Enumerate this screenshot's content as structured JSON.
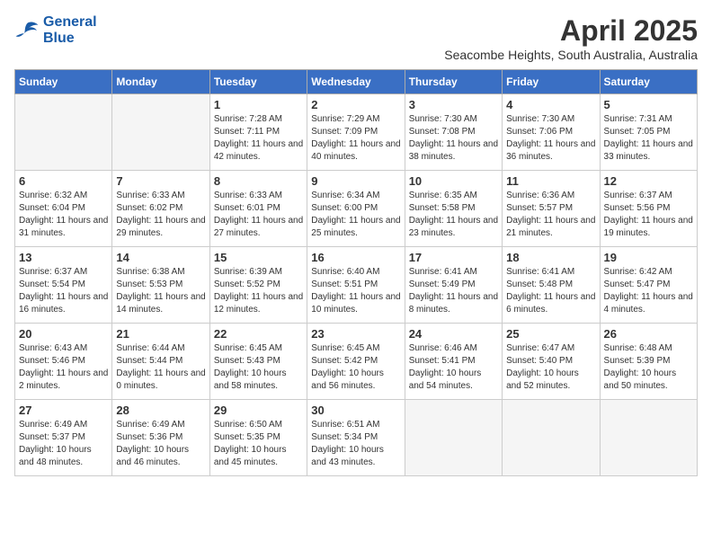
{
  "header": {
    "logo_line1": "General",
    "logo_line2": "Blue",
    "month": "April 2025",
    "location": "Seacombe Heights, South Australia, Australia"
  },
  "columns": [
    "Sunday",
    "Monday",
    "Tuesday",
    "Wednesday",
    "Thursday",
    "Friday",
    "Saturday"
  ],
  "weeks": [
    [
      {
        "num": "",
        "info": "",
        "empty": true
      },
      {
        "num": "",
        "info": "",
        "empty": true
      },
      {
        "num": "1",
        "info": "Sunrise: 7:28 AM\nSunset: 7:11 PM\nDaylight: 11 hours and 42 minutes."
      },
      {
        "num": "2",
        "info": "Sunrise: 7:29 AM\nSunset: 7:09 PM\nDaylight: 11 hours and 40 minutes."
      },
      {
        "num": "3",
        "info": "Sunrise: 7:30 AM\nSunset: 7:08 PM\nDaylight: 11 hours and 38 minutes."
      },
      {
        "num": "4",
        "info": "Sunrise: 7:30 AM\nSunset: 7:06 PM\nDaylight: 11 hours and 36 minutes."
      },
      {
        "num": "5",
        "info": "Sunrise: 7:31 AM\nSunset: 7:05 PM\nDaylight: 11 hours and 33 minutes."
      }
    ],
    [
      {
        "num": "6",
        "info": "Sunrise: 6:32 AM\nSunset: 6:04 PM\nDaylight: 11 hours and 31 minutes."
      },
      {
        "num": "7",
        "info": "Sunrise: 6:33 AM\nSunset: 6:02 PM\nDaylight: 11 hours and 29 minutes."
      },
      {
        "num": "8",
        "info": "Sunrise: 6:33 AM\nSunset: 6:01 PM\nDaylight: 11 hours and 27 minutes."
      },
      {
        "num": "9",
        "info": "Sunrise: 6:34 AM\nSunset: 6:00 PM\nDaylight: 11 hours and 25 minutes."
      },
      {
        "num": "10",
        "info": "Sunrise: 6:35 AM\nSunset: 5:58 PM\nDaylight: 11 hours and 23 minutes."
      },
      {
        "num": "11",
        "info": "Sunrise: 6:36 AM\nSunset: 5:57 PM\nDaylight: 11 hours and 21 minutes."
      },
      {
        "num": "12",
        "info": "Sunrise: 6:37 AM\nSunset: 5:56 PM\nDaylight: 11 hours and 19 minutes."
      }
    ],
    [
      {
        "num": "13",
        "info": "Sunrise: 6:37 AM\nSunset: 5:54 PM\nDaylight: 11 hours and 16 minutes."
      },
      {
        "num": "14",
        "info": "Sunrise: 6:38 AM\nSunset: 5:53 PM\nDaylight: 11 hours and 14 minutes."
      },
      {
        "num": "15",
        "info": "Sunrise: 6:39 AM\nSunset: 5:52 PM\nDaylight: 11 hours and 12 minutes."
      },
      {
        "num": "16",
        "info": "Sunrise: 6:40 AM\nSunset: 5:51 PM\nDaylight: 11 hours and 10 minutes."
      },
      {
        "num": "17",
        "info": "Sunrise: 6:41 AM\nSunset: 5:49 PM\nDaylight: 11 hours and 8 minutes."
      },
      {
        "num": "18",
        "info": "Sunrise: 6:41 AM\nSunset: 5:48 PM\nDaylight: 11 hours and 6 minutes."
      },
      {
        "num": "19",
        "info": "Sunrise: 6:42 AM\nSunset: 5:47 PM\nDaylight: 11 hours and 4 minutes."
      }
    ],
    [
      {
        "num": "20",
        "info": "Sunrise: 6:43 AM\nSunset: 5:46 PM\nDaylight: 11 hours and 2 minutes."
      },
      {
        "num": "21",
        "info": "Sunrise: 6:44 AM\nSunset: 5:44 PM\nDaylight: 11 hours and 0 minutes."
      },
      {
        "num": "22",
        "info": "Sunrise: 6:45 AM\nSunset: 5:43 PM\nDaylight: 10 hours and 58 minutes."
      },
      {
        "num": "23",
        "info": "Sunrise: 6:45 AM\nSunset: 5:42 PM\nDaylight: 10 hours and 56 minutes."
      },
      {
        "num": "24",
        "info": "Sunrise: 6:46 AM\nSunset: 5:41 PM\nDaylight: 10 hours and 54 minutes."
      },
      {
        "num": "25",
        "info": "Sunrise: 6:47 AM\nSunset: 5:40 PM\nDaylight: 10 hours and 52 minutes."
      },
      {
        "num": "26",
        "info": "Sunrise: 6:48 AM\nSunset: 5:39 PM\nDaylight: 10 hours and 50 minutes."
      }
    ],
    [
      {
        "num": "27",
        "info": "Sunrise: 6:49 AM\nSunset: 5:37 PM\nDaylight: 10 hours and 48 minutes."
      },
      {
        "num": "28",
        "info": "Sunrise: 6:49 AM\nSunset: 5:36 PM\nDaylight: 10 hours and 46 minutes."
      },
      {
        "num": "29",
        "info": "Sunrise: 6:50 AM\nSunset: 5:35 PM\nDaylight: 10 hours and 45 minutes."
      },
      {
        "num": "30",
        "info": "Sunrise: 6:51 AM\nSunset: 5:34 PM\nDaylight: 10 hours and 43 minutes."
      },
      {
        "num": "",
        "info": "",
        "empty": true
      },
      {
        "num": "",
        "info": "",
        "empty": true
      },
      {
        "num": "",
        "info": "",
        "empty": true
      }
    ]
  ]
}
